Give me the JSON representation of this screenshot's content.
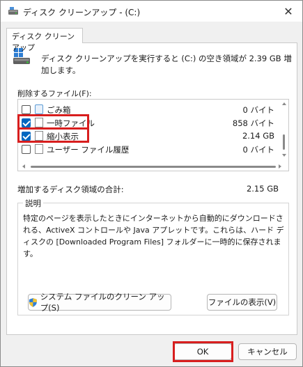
{
  "window": {
    "title": "ディスク クリーンアップ - (C:)",
    "close_glyph": "✕"
  },
  "tab": {
    "label": "ディスク クリーンアップ"
  },
  "intro": {
    "text": "ディスク クリーンアップを実行すると (C:) の空き領域が 2.39 GB 増加します。"
  },
  "files": {
    "label": "削除するファイル(F):",
    "items": [
      {
        "name": "ごみ箱",
        "size": "0 バイト",
        "checked": false,
        "icon": "recycle-bin-icon"
      },
      {
        "name": "一時ファイル",
        "size": "858 バイト",
        "checked": true,
        "icon": "file-icon"
      },
      {
        "name": "縮小表示",
        "size": "2.14 GB",
        "checked": true,
        "icon": "file-icon"
      },
      {
        "name": "ユーザー ファイル履歴",
        "size": "0 バイト",
        "checked": false,
        "icon": "file-icon"
      }
    ]
  },
  "total": {
    "label": "増加するディスク領域の合計:",
    "value": "2.15 GB"
  },
  "description": {
    "label": "説明",
    "text": "特定のページを表示したときにインターネットから自動的にダウンロードされる、ActiveX コントロールや Java アプレットです。これらは、ハード ディスクの [Downloaded Program Files] フォルダーに一時的に保存されます。"
  },
  "buttons": {
    "cleanup_system": "システム ファイルのクリーン アップ(S)",
    "view_files": "ファイルの表示(V)",
    "ok": "OK",
    "cancel": "キャンセル"
  },
  "colors": {
    "accent": "#0067c0",
    "highlight": "#d81e1e"
  }
}
